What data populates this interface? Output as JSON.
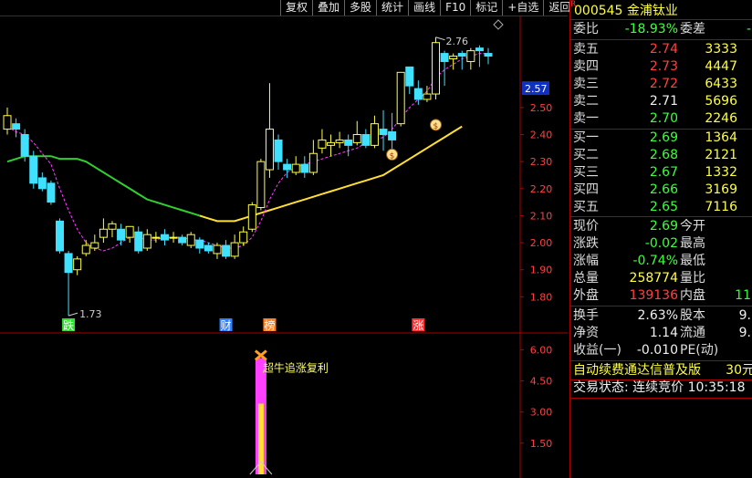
{
  "toolbar": {
    "items": [
      "复权",
      "叠加",
      "多股",
      "统计",
      "画线",
      "F10",
      "标记",
      "+自选",
      "返回"
    ]
  },
  "chart_data": {
    "type": "candlestick",
    "price_axis": {
      "ticks": [
        "2.50",
        "2.40",
        "2.30",
        "2.20",
        "2.10",
        "2.00",
        "1.90",
        "1.80"
      ],
      "current_price_tag": "2.57"
    },
    "candles": [
      [
        2.42,
        2.47,
        2.5,
        2.4
      ],
      [
        2.44,
        2.42,
        2.46,
        2.39
      ],
      [
        2.4,
        2.32,
        2.42,
        2.3
      ],
      [
        2.32,
        2.22,
        2.34,
        2.2
      ],
      [
        2.24,
        2.2,
        2.26,
        2.19
      ],
      [
        2.22,
        2.15,
        2.23,
        2.14
      ],
      [
        2.08,
        1.97,
        2.09,
        1.96
      ],
      [
        1.96,
        1.89,
        1.97,
        1.73
      ],
      [
        1.9,
        1.94,
        1.95,
        1.88
      ],
      [
        1.96,
        1.99,
        2.01,
        1.95
      ],
      [
        1.98,
        2.0,
        2.03,
        1.97
      ],
      [
        2.02,
        2.05,
        2.09,
        2.0
      ],
      [
        2.05,
        2.07,
        2.08,
        2.02
      ],
      [
        2.05,
        2.01,
        2.07,
        1.99
      ],
      [
        2.02,
        2.06,
        2.06,
        2.0
      ],
      [
        2.04,
        1.97,
        2.06,
        1.96
      ],
      [
        1.98,
        2.03,
        2.05,
        1.97
      ],
      [
        2.02,
        2.02,
        2.04,
        2.0
      ],
      [
        2.03,
        2.01,
        2.05,
        1.99
      ],
      [
        2.02,
        2.02,
        2.04,
        2.0
      ],
      [
        2.02,
        2.0,
        2.03,
        1.99
      ],
      [
        1.99,
        2.03,
        2.04,
        1.98
      ],
      [
        2.01,
        1.98,
        2.02,
        1.96
      ],
      [
        1.99,
        1.97,
        2.0,
        1.96
      ],
      [
        1.96,
        1.99,
        2.0,
        1.94
      ],
      [
        1.99,
        1.95,
        2.01,
        1.94
      ],
      [
        1.95,
        2.0,
        2.03,
        1.94
      ],
      [
        2.0,
        2.04,
        2.06,
        1.99
      ],
      [
        2.05,
        2.14,
        2.15,
        2.04
      ],
      [
        2.13,
        2.3,
        2.31,
        2.12
      ],
      [
        2.27,
        2.42,
        2.59,
        2.24
      ],
      [
        2.38,
        2.3,
        2.4,
        2.27
      ],
      [
        2.29,
        2.27,
        2.31,
        2.24
      ],
      [
        2.26,
        2.29,
        2.32,
        2.25
      ],
      [
        2.29,
        2.26,
        2.32,
        2.24
      ],
      [
        2.26,
        2.33,
        2.38,
        2.25
      ],
      [
        2.35,
        2.38,
        2.42,
        2.33
      ],
      [
        2.36,
        2.37,
        2.4,
        2.32
      ],
      [
        2.37,
        2.38,
        2.41,
        2.35
      ],
      [
        2.38,
        2.36,
        2.4,
        2.32
      ],
      [
        2.37,
        2.4,
        2.45,
        2.36
      ],
      [
        2.4,
        2.36,
        2.42,
        2.35
      ],
      [
        2.36,
        2.44,
        2.47,
        2.35
      ],
      [
        2.42,
        2.4,
        2.49,
        2.34
      ],
      [
        2.41,
        2.38,
        2.48,
        2.34
      ],
      [
        2.44,
        2.63,
        2.63,
        2.43
      ],
      [
        2.65,
        2.58,
        2.65,
        2.55
      ],
      [
        2.57,
        2.53,
        2.6,
        2.51
      ],
      [
        2.53,
        2.55,
        2.58,
        2.52
      ],
      [
        2.55,
        2.74,
        2.76,
        2.53
      ],
      [
        2.7,
        2.67,
        2.71,
        2.58
      ],
      [
        2.68,
        2.69,
        2.7,
        2.64
      ],
      [
        2.7,
        2.69,
        2.71,
        2.64
      ],
      [
        2.67,
        2.71,
        2.72,
        2.64
      ],
      [
        2.72,
        2.71,
        2.73,
        2.65
      ],
      [
        2.7,
        2.69,
        2.72,
        2.66
      ]
    ],
    "ma_yellow": [
      2.3,
      2.31,
      2.32,
      2.32,
      2.32,
      2.32,
      2.31,
      2.31,
      2.31,
      2.3,
      2.28,
      2.26,
      2.24,
      2.22,
      2.2,
      2.18,
      2.16,
      2.15,
      2.14,
      2.13,
      2.12,
      2.11,
      2.1,
      2.09,
      2.08,
      2.08,
      2.08,
      2.09,
      2.1,
      2.11,
      2.12,
      2.13,
      2.14,
      2.15,
      2.16,
      2.17,
      2.18,
      2.19,
      2.2,
      2.21,
      2.22,
      2.23,
      2.24,
      2.25,
      2.27,
      2.29,
      2.31,
      2.33,
      2.35,
      2.37,
      2.39,
      2.41,
      2.43
    ],
    "ma_magenta": [
      2.43,
      2.41,
      2.4,
      2.37,
      2.33,
      2.29,
      2.2,
      2.12,
      2.05,
      2.0,
      1.98,
      1.97,
      1.98,
      2.0,
      2.02,
      2.02,
      2.01,
      2.01,
      2.02,
      2.02,
      2.02,
      2.01,
      2.01,
      2.0,
      1.99,
      1.98,
      1.98,
      1.99,
      2.02,
      2.08,
      2.16,
      2.22,
      2.26,
      2.28,
      2.29,
      2.3,
      2.31,
      2.32,
      2.33,
      2.34,
      2.35,
      2.37,
      2.38,
      2.39,
      2.42,
      2.46,
      2.5,
      2.53,
      2.56,
      2.61,
      2.64,
      2.66,
      2.68,
      2.69,
      2.7,
      2.7
    ],
    "annotations": {
      "high_label": "2.76",
      "low_label": "1.73"
    },
    "event_markers": [
      {
        "label": "跌",
        "color": "#30e030",
        "index": 7
      },
      {
        "label": "财",
        "color": "#3080ff",
        "index": 25
      },
      {
        "label": "榜",
        "color": "#ff8020",
        "index": 30
      },
      {
        "label": "涨",
        "color": "#ff3030",
        "index": 47
      }
    ],
    "indicator": {
      "ticks": [
        "6.00",
        "4.50",
        "3.00",
        "1.50"
      ],
      "signal_label": "超牛追涨复利",
      "signal_index": 29,
      "signal_value": 5.6
    }
  },
  "quote": {
    "code": "000545",
    "name": "金浦钛业",
    "weibi_label": "委比",
    "weibi_value": "-18.93%",
    "weicha_label": "委差",
    "weicha_value": "-",
    "sells": [
      {
        "label": "卖五",
        "price": "2.74",
        "vol": "3333"
      },
      {
        "label": "卖四",
        "price": "2.73",
        "vol": "4447"
      },
      {
        "label": "卖三",
        "price": "2.72",
        "vol": "6433"
      },
      {
        "label": "卖二",
        "price": "2.71",
        "vol": "5696"
      },
      {
        "label": "卖一",
        "price": "2.70",
        "vol": "2246"
      }
    ],
    "buys": [
      {
        "label": "买一",
        "price": "2.69",
        "vol": "1364"
      },
      {
        "label": "买二",
        "price": "2.68",
        "vol": "2121"
      },
      {
        "label": "买三",
        "price": "2.67",
        "vol": "1332"
      },
      {
        "label": "买四",
        "price": "2.66",
        "vol": "3169"
      },
      {
        "label": "买五",
        "price": "2.65",
        "vol": "7116"
      }
    ],
    "stats": [
      {
        "l1": "现价",
        "v1": "2.69",
        "l2": "今开",
        "v2": ""
      },
      {
        "l1": "涨跌",
        "v1": "-0.02",
        "l2": "最高",
        "v2": ""
      },
      {
        "l1": "涨幅",
        "v1": "-0.74%",
        "l2": "最低",
        "v2": ""
      },
      {
        "l1": "总量",
        "v1": "258774",
        "l2": "量比",
        "v2": ""
      },
      {
        "l1": "外盘",
        "v1": "139136",
        "l2": "内盘",
        "v2": "11"
      }
    ],
    "stats2": [
      {
        "l1": "换手",
        "v1": "2.63%",
        "l2": "股本",
        "v2": "9."
      },
      {
        "l1": "净资",
        "v1": "1.14",
        "l2": "流通",
        "v2": "9."
      },
      {
        "l1": "收益(一)",
        "v1": "-0.010",
        "l2": "PE(动)",
        "v2": ""
      }
    ],
    "promo_text": "自动续费通达信普及版",
    "promo_price": "30元",
    "status_text": "交易状态: 连续竞价 10:35:18"
  }
}
